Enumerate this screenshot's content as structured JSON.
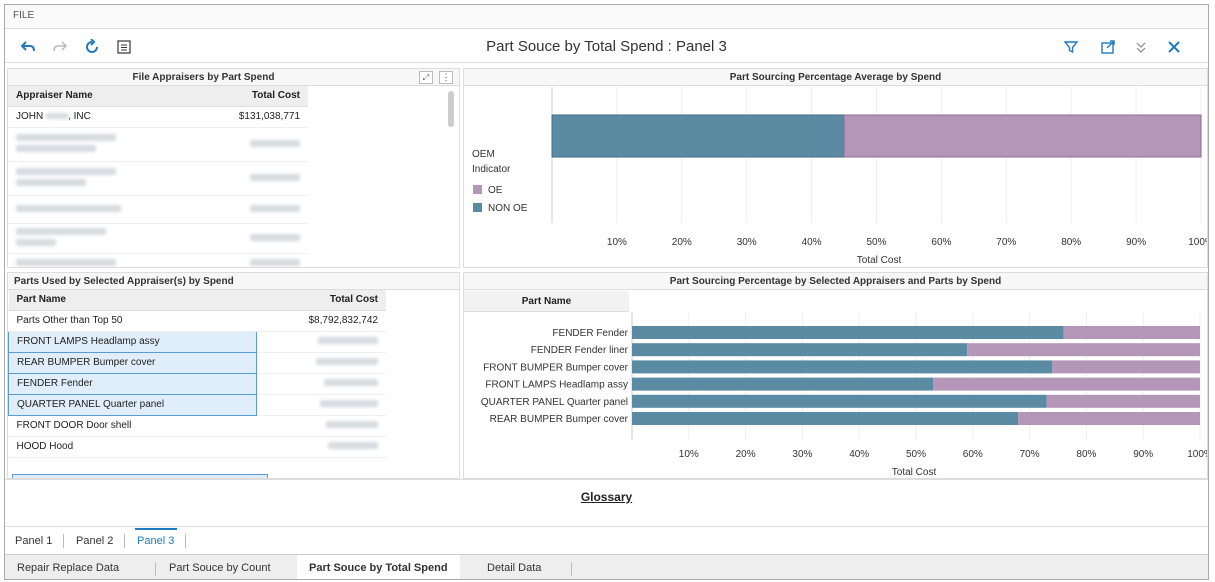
{
  "menubar": {
    "file_label": "FILE"
  },
  "toolbar": {
    "title": "Part Souce by Total Spend : Panel 3"
  },
  "appraisers_panel": {
    "title": "File Appraisers by Part Spend",
    "col_name": "Appraiser Name",
    "col_cost": "Total Cost",
    "first_row": {
      "name_part1": "JOHN",
      "name_part2": ", INC",
      "cost": "$131,038,771"
    }
  },
  "oem_chart": {
    "title": "Part Sourcing Percentage Average by Spend",
    "legend_title_line1": "OEM",
    "legend_title_line2": "Indicator",
    "legend_oe": "OE",
    "legend_non_oe": "NON OE",
    "xlabel": "Total Cost",
    "ticks": [
      "10%",
      "20%",
      "30%",
      "40%",
      "50%",
      "60%",
      "70%",
      "80%",
      "90%",
      "100%"
    ],
    "colors": {
      "non_oe": "#5b8aa3",
      "oe": "#b396b8"
    }
  },
  "parts_panel": {
    "title": "Parts Used by Selected Appraiser(s) by Spend",
    "col_name": "Part Name",
    "col_cost": "Total Cost",
    "rows": [
      {
        "name": "Parts Other than Top 50",
        "cost": "$8,792,832,742"
      },
      {
        "name": "FRONT LAMPS Headlamp assy",
        "cost": ""
      },
      {
        "name": "REAR BUMPER Bumper cover",
        "cost": ""
      },
      {
        "name": "FENDER Fender",
        "cost": ""
      },
      {
        "name": "QUARTER PANEL Quarter panel",
        "cost": ""
      },
      {
        "name": "FRONT DOOR Door shell",
        "cost": ""
      },
      {
        "name": "HOOD Hood",
        "cost": ""
      }
    ]
  },
  "parts_chart": {
    "title": "Part Sourcing Percentage by Selected Appraisers and Parts by Spend",
    "col_header": "Part Name",
    "xlabel": "Total Cost",
    "ticks": [
      "10%",
      "20%",
      "30%",
      "40%",
      "50%",
      "60%",
      "70%",
      "80%",
      "90%",
      "100%"
    ]
  },
  "glossary_label": "Glossary",
  "page_tabs": [
    "Panel 1",
    "Panel 2",
    "Panel 3"
  ],
  "bottom_tabs": [
    "Repair Replace Data",
    "Part Souce by Count",
    "Part Souce by Total Spend",
    "Detail Data"
  ],
  "chart_data": [
    {
      "type": "bar",
      "title": "Part Sourcing Percentage Average by Spend",
      "xlabel": "Total Cost",
      "xlim": [
        0,
        100
      ],
      "legend": [
        "OE",
        "NON OE"
      ],
      "series": [
        {
          "name": "NON OE",
          "values": [
            45
          ]
        },
        {
          "name": "OE",
          "values": [
            55
          ]
        }
      ]
    },
    {
      "type": "bar",
      "title": "Part Sourcing Percentage by Selected Appraisers and Parts by Spend",
      "xlabel": "Total Cost",
      "xlim": [
        0,
        100
      ],
      "categories": [
        "FENDER Fender",
        "FENDER Fender liner",
        "FRONT BUMPER Bumper cover",
        "FRONT LAMPS Headlamp assy",
        "QUARTER PANEL Quarter panel",
        "REAR BUMPER Bumper cover"
      ],
      "series": [
        {
          "name": "NON OE",
          "values": [
            76,
            59,
            74,
            53,
            73,
            68
          ]
        },
        {
          "name": "OE",
          "values": [
            24,
            41,
            26,
            47,
            27,
            32
          ]
        }
      ]
    }
  ]
}
